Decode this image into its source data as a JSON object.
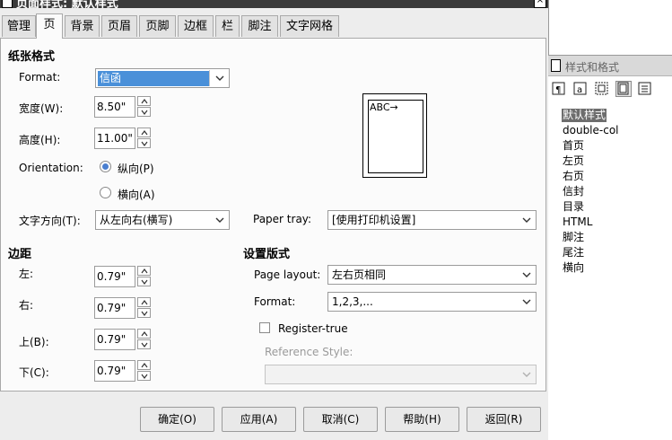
{
  "window": {
    "title": "页面样式: 默认样式",
    "close_glyph": "×"
  },
  "tabs": [
    {
      "label": "管理"
    },
    {
      "label": "页"
    },
    {
      "label": "背景"
    },
    {
      "label": "页眉"
    },
    {
      "label": "页脚"
    },
    {
      "label": "边框"
    },
    {
      "label": "栏"
    },
    {
      "label": "脚注"
    },
    {
      "label": "文字网格"
    }
  ],
  "active_tab": "页",
  "paper": {
    "section": "纸张格式",
    "format_label": "Format:",
    "format_value": "信函",
    "width_label": "宽度(W):",
    "width_value": "8.50\"",
    "height_label": "高度(H):",
    "height_value": "11.00\"",
    "orientation_label": "Orientation:",
    "portrait_label": "纵向(P)",
    "landscape_label": "横向(A)",
    "orientation_selected": "纵向(P)",
    "text_direction_label": "文字方向(T):",
    "text_direction_value": "从左向右(横写)",
    "paper_tray_label": "Paper tray:",
    "paper_tray_value": "[使用打印机设置]",
    "preview_text": "ABC→"
  },
  "margins": {
    "section": "边距",
    "left_label": "左:",
    "left_value": "0.79\"",
    "right_label": "右:",
    "right_value": "0.79\"",
    "top_label": "上(B):",
    "top_value": "0.79\"",
    "bottom_label": "下(C):",
    "bottom_value": "0.79\""
  },
  "layout": {
    "section": "设置版式",
    "page_layout_label": "Page layout:",
    "page_layout_value": "左右页相同",
    "format_label": "Format:",
    "format_value": "1,2,3,...",
    "register_true_label": "Register-true",
    "register_true_checked": false,
    "reference_style_label": "Reference Style:",
    "reference_style_value": ""
  },
  "buttons": {
    "ok": "确定(O)",
    "apply": "应用(A)",
    "cancel": "取消(C)",
    "help": "帮助(H)",
    "back": "返回(R)"
  },
  "styles_panel": {
    "title": "样式和格式",
    "toolbar_icons": [
      "paragraph-styles-icon",
      "character-styles-icon",
      "frame-styles-icon",
      "page-styles-icon",
      "list-styles-icon"
    ],
    "items": [
      "默认样式",
      "double-col",
      "首页",
      "左页",
      "右页",
      "信封",
      "目录",
      "HTML",
      "脚注",
      "尾注",
      "横向"
    ],
    "selected": "默认样式"
  },
  "colors": {
    "accent": "#4a90d9",
    "selection_gray": "#6d6d6d"
  }
}
